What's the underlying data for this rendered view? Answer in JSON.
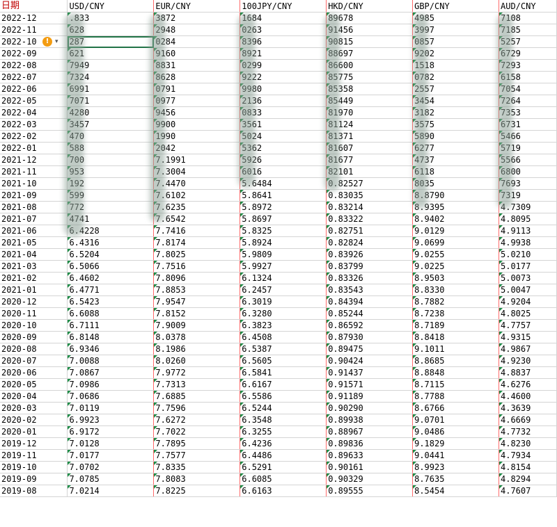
{
  "headers": {
    "date": "日期",
    "usd": "USD/CNY",
    "eur": "EUR/CNY",
    "jpy": "100JPY/CNY",
    "hkd": "HKD/CNY",
    "gbp": "GBP/CNY",
    "aud": "AUD/CNY"
  },
  "rows": [
    [
      "2022-12",
      ".833",
      "3872",
      "1684",
      "89678",
      "4985",
      "7108"
    ],
    [
      "2022-11",
      "628",
      "2948",
      "0263",
      "91456",
      "3997",
      "7185"
    ],
    [
      "2022-10",
      "287",
      "0284",
      "8396",
      "90815",
      "0857",
      "5257"
    ],
    [
      "2022-09",
      "621",
      "9160",
      "8921",
      "88697",
      "9202",
      "6729"
    ],
    [
      "2022-08",
      "7949",
      "8831",
      "0299",
      "86600",
      "1518",
      "7293"
    ],
    [
      "2022-07",
      "7324",
      "8628",
      "9222",
      "85775",
      "0782",
      "6158"
    ],
    [
      "2022-06",
      "6991",
      "0791",
      "9980",
      "85358",
      "2557",
      "7054"
    ],
    [
      "2022-05",
      "7071",
      "0977",
      "2136",
      "85449",
      "3454",
      "7264"
    ],
    [
      "2022-04",
      "4280",
      "9456",
      "0833",
      "81970",
      "3182",
      "7353"
    ],
    [
      "2022-03",
      "3457",
      "9900",
      "3561",
      "81124",
      "3575",
      "6731"
    ],
    [
      "2022-02",
      "470",
      "1990",
      "5024",
      "81371",
      "5890",
      "5466"
    ],
    [
      "2022-01",
      "588",
      "2042",
      "5362",
      "81607",
      "6277",
      "5719"
    ],
    [
      "2021-12",
      "700",
      "7.1991",
      "5926",
      "81677",
      "4737",
      "5566"
    ],
    [
      "2021-11",
      "953",
      "7.3004",
      "6016",
      "82101",
      "6118",
      "6800"
    ],
    [
      "2021-10",
      "192",
      "7.4470",
      "5.6484",
      "0.82527",
      "8035",
      "7693"
    ],
    [
      "2021-09",
      "599",
      "7.6102",
      "5.8641",
      "0.83035",
      "8.8790",
      "7319"
    ],
    [
      "2021-08",
      "772",
      "7.6235",
      "5.8972",
      "0.83214",
      "8.9395",
      "4.7309"
    ],
    [
      "2021-07",
      "4741",
      "7.6542",
      "5.8697",
      "0.83322",
      "8.9402",
      "4.8095"
    ],
    [
      "2021-06",
      "6.4228",
      "7.7416",
      "5.8325",
      "0.82751",
      "9.0129",
      "4.9113"
    ],
    [
      "2021-05",
      "6.4316",
      "7.8174",
      "5.8924",
      "0.82824",
      "9.0699",
      "4.9938"
    ],
    [
      "2021-04",
      "6.5204",
      "7.8025",
      "5.9809",
      "0.83926",
      "9.0255",
      "5.0210"
    ],
    [
      "2021-03",
      "6.5066",
      "7.7516",
      "5.9927",
      "0.83799",
      "9.0225",
      "5.0177"
    ],
    [
      "2021-02",
      "6.4602",
      "7.8096",
      "6.1324",
      "0.83326",
      "8.9503",
      "5.0073"
    ],
    [
      "2021-01",
      "6.4771",
      "7.8853",
      "6.2457",
      "0.83543",
      "8.8330",
      "5.0047"
    ],
    [
      "2020-12",
      "6.5423",
      "7.9547",
      "6.3019",
      "0.84394",
      "8.7882",
      "4.9204"
    ],
    [
      "2020-11",
      "6.6088",
      "7.8152",
      "6.3280",
      "0.85244",
      "8.7238",
      "4.8025"
    ],
    [
      "2020-10",
      "6.7111",
      "7.9009",
      "6.3823",
      "0.86592",
      "8.7189",
      "4.7757"
    ],
    [
      "2020-09",
      "6.8148",
      "8.0378",
      "6.4508",
      "0.87930",
      "8.8418",
      "4.9315"
    ],
    [
      "2020-08",
      "6.9346",
      "8.1986",
      "6.5387",
      "0.89475",
      "9.1011",
      "4.9867"
    ],
    [
      "2020-07",
      "7.0088",
      "8.0260",
      "6.5605",
      "0.90424",
      "8.8685",
      "4.9230"
    ],
    [
      "2020-06",
      "7.0867",
      "7.9772",
      "6.5841",
      "0.91437",
      "8.8848",
      "4.8837"
    ],
    [
      "2020-05",
      "7.0986",
      "7.7313",
      "6.6167",
      "0.91571",
      "8.7115",
      "4.6276"
    ],
    [
      "2020-04",
      "7.0686",
      "7.6885",
      "6.5586",
      "0.91189",
      "8.7788",
      "4.4600"
    ],
    [
      "2020-03",
      "7.0119",
      "7.7596",
      "6.5244",
      "0.90290",
      "8.6766",
      "4.3639"
    ],
    [
      "2020-02",
      "6.9923",
      "7.6272",
      "6.3548",
      "0.89938",
      "9.0701",
      "4.6669"
    ],
    [
      "2020-01",
      "6.9172",
      "7.7022",
      "6.3255",
      "0.88967",
      "9.0486",
      "4.7732"
    ],
    [
      "2019-12",
      "7.0128",
      "7.7895",
      "6.4236",
      "0.89836",
      "9.1829",
      "4.8230"
    ],
    [
      "2019-11",
      "7.0177",
      "7.7577",
      "6.4486",
      "0.89633",
      "9.0441",
      "4.7934"
    ],
    [
      "2019-10",
      "7.0702",
      "7.8335",
      "6.5291",
      "0.90161",
      "8.9923",
      "4.8154"
    ],
    [
      "2019-09",
      "7.0785",
      "7.8083",
      "6.6085",
      "0.90329",
      "8.7635",
      "4.8294"
    ],
    [
      "2019-08",
      "7.0214",
      "7.8225",
      "6.6163",
      "0.89555",
      "8.5454",
      "4.7607"
    ]
  ],
  "warning_icon": {
    "name": "warning-icon",
    "glyph": "!",
    "color": "#f39c12"
  },
  "selection_color": "#217346",
  "triangle_color": "#1e8c47"
}
